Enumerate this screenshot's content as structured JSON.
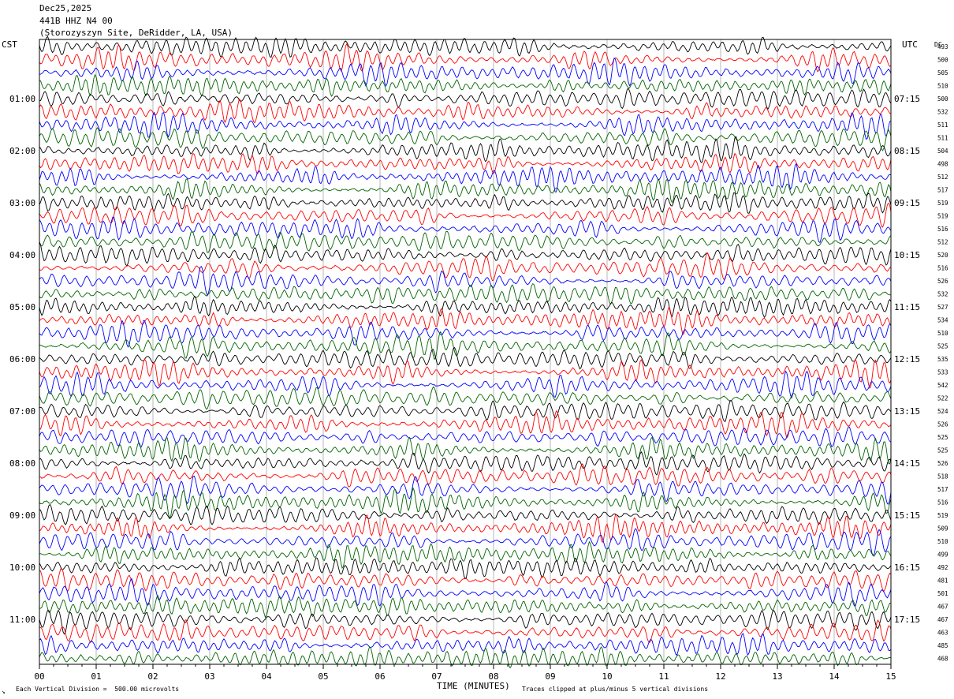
{
  "header": {
    "date": "Dec25,2025",
    "station": "441B HHZ N4 00",
    "site": "(Storozyszyn Site, DeRidder, LA, USA)"
  },
  "left_zone": "CST",
  "right_zone": "UTC",
  "dc_label": "DC",
  "footer": {
    "xlabel": "TIME (MINUTES)",
    "scale_note": "Each Vertical Division =  500.00 microvolts",
    "clip_note": "Traces clipped at plus/minus 5 vertical divisions",
    "corner_mark": "↘"
  },
  "chart_data": {
    "type": "line",
    "title": "441B HHZ N4 00",
    "xlabel": "TIME (MINUTES)",
    "x_ticks": [
      "00",
      "01",
      "02",
      "03",
      "04",
      "05",
      "06",
      "07",
      "08",
      "09",
      "10",
      "11",
      "12",
      "13",
      "14",
      "15"
    ],
    "xlim": [
      0,
      15
    ],
    "traces_per_hour": 4,
    "trace_colors": [
      "#000000",
      "#ff0000",
      "#0000ff",
      "#006400"
    ],
    "left_time_labels": [
      "01:00",
      "02:00",
      "03:00",
      "04:00",
      "05:00",
      "06:00",
      "07:00",
      "08:00",
      "09:00",
      "10:00",
      "11:00"
    ],
    "right_time_labels": [
      "07:15",
      "08:15",
      "09:15",
      "10:15",
      "11:15",
      "12:15",
      "13:15",
      "14:15",
      "15:15",
      "16:15",
      "17:15"
    ],
    "dc_offsets": [
      493,
      500,
      505,
      510,
      500,
      532,
      511,
      511,
      504,
      498,
      512,
      517,
      519,
      519,
      516,
      512,
      520,
      516,
      526,
      532,
      527,
      534,
      510,
      525,
      535,
      533,
      542,
      522,
      524,
      526,
      525,
      525,
      526,
      518,
      517,
      516,
      519,
      509,
      510,
      499,
      492,
      481,
      501,
      467,
      467,
      463,
      485,
      468
    ],
    "grid": true
  }
}
